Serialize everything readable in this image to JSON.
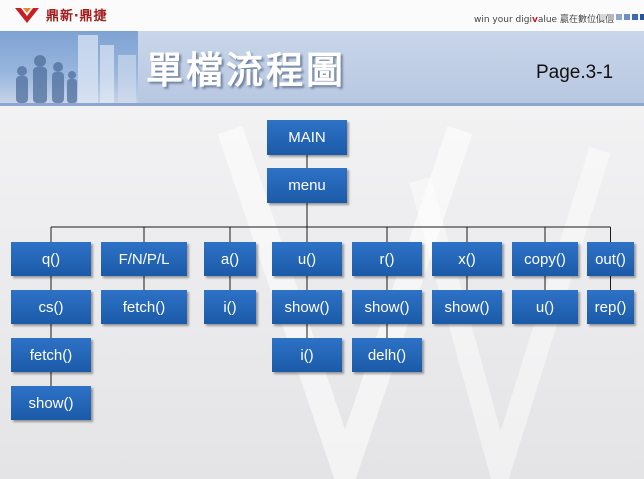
{
  "header": {
    "logo_text": "鼎新‧鼎捷",
    "tagline_prefix": "win your digi",
    "tagline_mark": "v",
    "tagline_suffix": "alue 贏在數位價值",
    "brand_color": "#a01e1e",
    "square_colors": [
      "#d6d6d6",
      "#b8b8b8",
      "#8fa8d2",
      "#6f8fc2",
      "#3d6ab0",
      "#2a52a0"
    ]
  },
  "slide": {
    "title": "單檔流程圖",
    "page_label": "Page.3-1"
  },
  "diagram": {
    "node_color": "#1f62b4",
    "root": "MAIN",
    "menu": "menu",
    "branches": [
      {
        "label": "q()",
        "children": [
          "cs()",
          "fetch()",
          "show()"
        ]
      },
      {
        "label": "F/N/P/L",
        "children": [
          "fetch()"
        ]
      },
      {
        "label": "a()",
        "children": [
          "i()"
        ]
      },
      {
        "label": "u()",
        "children": [
          "show()",
          "i()"
        ]
      },
      {
        "label": "r()",
        "children": [
          "show()",
          "delh()"
        ]
      },
      {
        "label": "x()",
        "children": [
          "show()"
        ]
      },
      {
        "label": "copy()",
        "children": [
          "u()"
        ]
      },
      {
        "label": "out()",
        "children": [
          "rep()"
        ]
      }
    ]
  }
}
